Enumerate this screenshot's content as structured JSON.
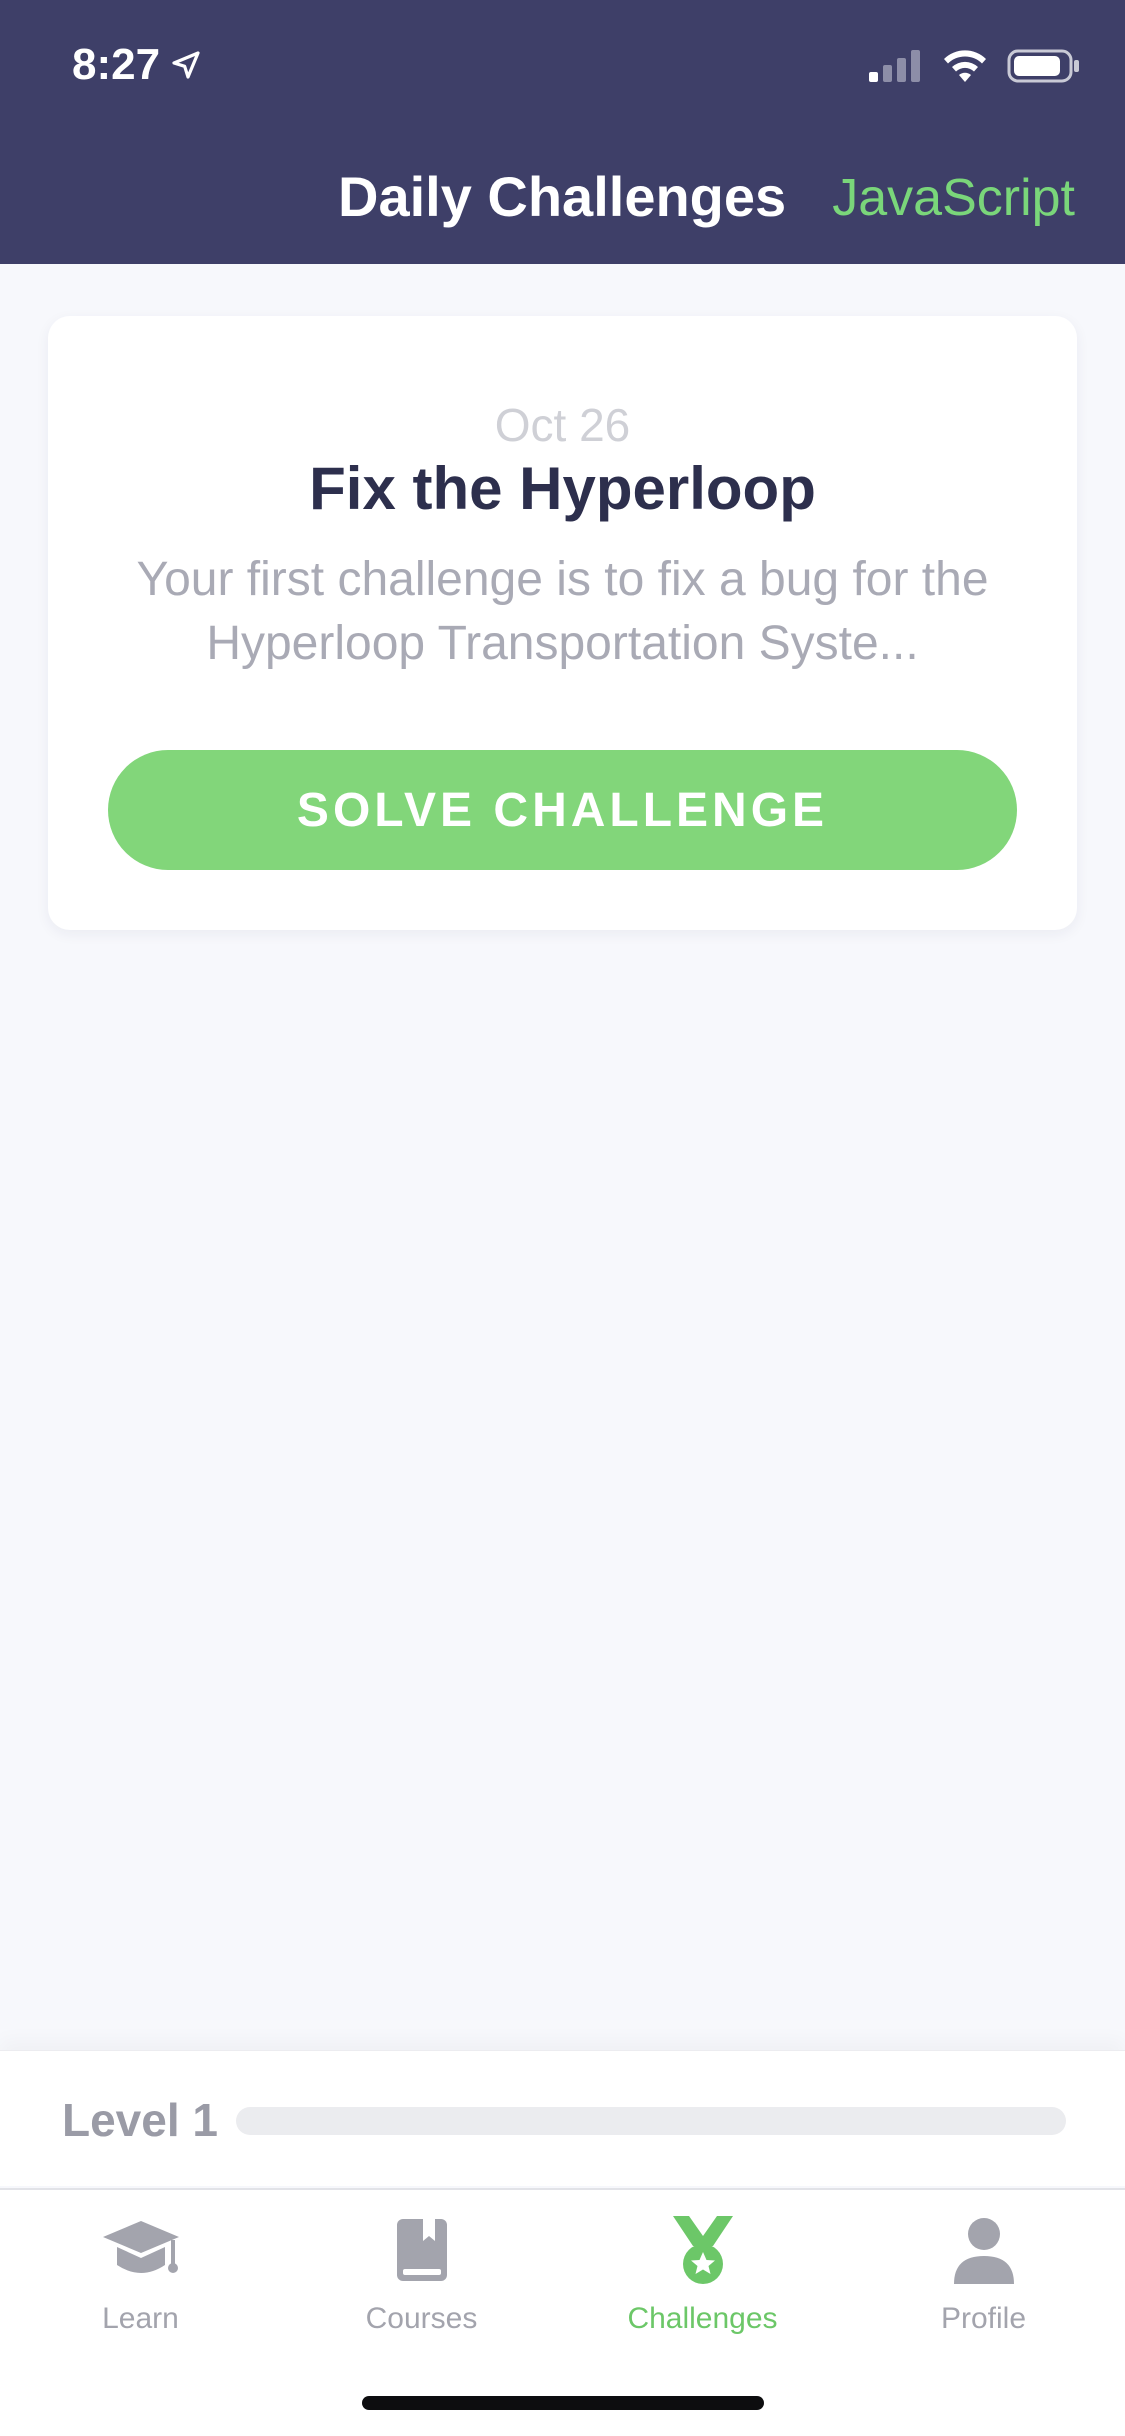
{
  "status_bar": {
    "time": "8:27",
    "icons": [
      "location-arrow-icon",
      "signal-icon",
      "wifi-icon",
      "battery-icon"
    ]
  },
  "header": {
    "title": "Daily Challenges",
    "language": "JavaScript"
  },
  "challenge": {
    "date": "Oct 26",
    "title": "Fix the Hyperloop",
    "description": "Your first challenge is to fix a bug for the Hyperloop Transportation Syste...",
    "button_label": "SOLVE CHALLENGE"
  },
  "level": {
    "label": "Level 1",
    "progress_percent": 0
  },
  "tabs": [
    {
      "label": "Learn",
      "icon": "graduation-cap-icon",
      "active": false
    },
    {
      "label": "Courses",
      "icon": "book-icon",
      "active": false
    },
    {
      "label": "Challenges",
      "icon": "medal-icon",
      "active": true
    },
    {
      "label": "Profile",
      "icon": "user-icon",
      "active": false
    }
  ],
  "colors": {
    "header_bg": "#3e3f68",
    "accent_green": "#82d67a",
    "page_bg": "#f7f8fc",
    "title_text": "#2d2f4d"
  }
}
